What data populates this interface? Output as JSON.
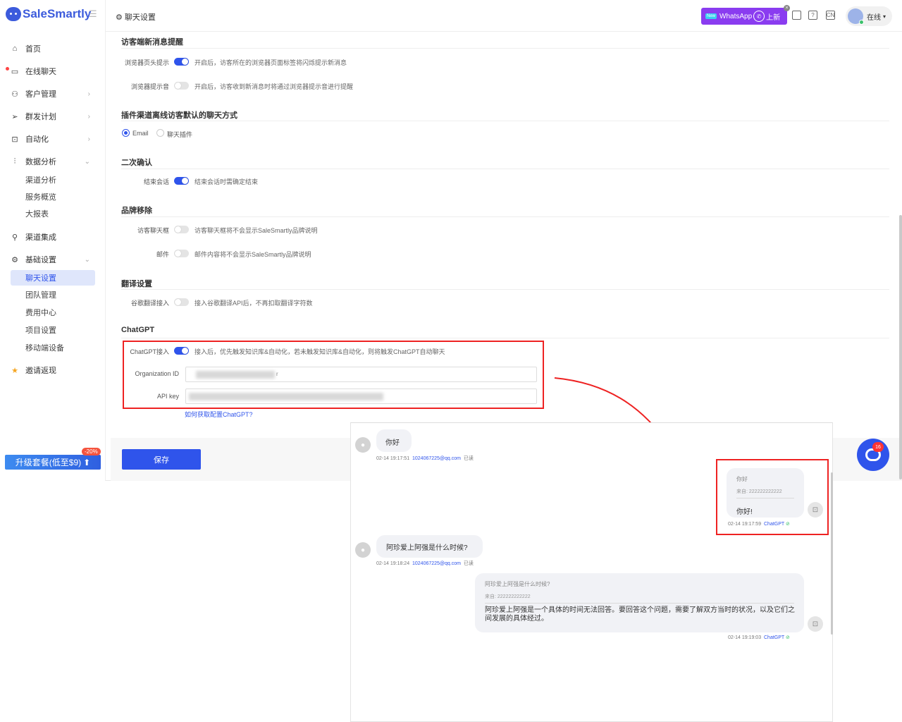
{
  "brand": {
    "name": "SaleSmartly"
  },
  "sidebar": {
    "items": [
      {
        "label": "首页",
        "icon": "home-icon"
      },
      {
        "label": "在线聊天",
        "icon": "chat-icon"
      },
      {
        "label": "客户管理",
        "icon": "users-icon"
      },
      {
        "label": "群发计划",
        "icon": "send-icon"
      },
      {
        "label": "自动化",
        "icon": "robot-icon"
      },
      {
        "label": "数据分析",
        "icon": "analytics-icon"
      },
      {
        "label": "渠道集成",
        "icon": "channels-icon"
      },
      {
        "label": "基础设置",
        "icon": "settings-icon"
      },
      {
        "label": "邀请返现",
        "icon": "star-icon"
      }
    ],
    "analytics_sub": [
      "渠道分析",
      "服务概览",
      "大报表"
    ],
    "settings_sub": [
      "聊天设置",
      "团队管理",
      "费用中心",
      "项目设置",
      "移动端设备"
    ],
    "upgrade_label": "升级套餐(低至$9)",
    "upgrade_badge": "-20%"
  },
  "header": {
    "breadcrumb": "聊天设置",
    "wa_new": "New",
    "wa_label": "WhatsApp",
    "wa_suffix": "上新",
    "wa_close": "×",
    "status": "在线"
  },
  "settings": {
    "sec1_title": "访客端新消息提醒",
    "browser_tab_label": "浏览器页头提示",
    "browser_tab_on": true,
    "browser_tab_desc": "开启后，访客所在的浏览器页面标签将闪烁提示新消息",
    "browser_sound_label": "浏览器提示音",
    "browser_sound_on": false,
    "browser_sound_desc": "开启后，访客收到新消息时将通过浏览器提示音进行提醒",
    "sec2_title": "插件渠道离线访客默认的聊天方式",
    "radio_email": "Email",
    "radio_plugin": "聊天插件",
    "sec3_title": "二次确认",
    "end_chat_label": "结束会话",
    "end_chat_on": true,
    "end_chat_desc": "结束会话时需确定结束",
    "sec4_title": "品牌移除",
    "visitor_box_label": "访客聊天框",
    "visitor_box_desc": "访客聊天框将不会显示SaleSmartly品牌说明",
    "mail_label": "邮件",
    "mail_desc": "邮件内容将不会显示SaleSmartly品牌说明",
    "sec5_title": "翻译设置",
    "google_label": "谷歌翻译接入",
    "google_desc": "接入谷歌翻译API后，不再扣取翻译字符数",
    "sec6_title": "ChatGPT",
    "gpt_label": "ChatGPT接入",
    "gpt_on": true,
    "gpt_desc": "接入后，优先触发知识库&自动化，若未触发知识库&自动化，则将触发ChatGPT自动聊天",
    "org_label": "Organization ID",
    "org_suffix": "r",
    "api_label": "API key",
    "help_link": "如何获取配置ChatGPT?",
    "save_label": "保存"
  },
  "chat": {
    "messages": [
      {
        "text": "你好",
        "time": "02-14 19:17:51",
        "email": "1024067225@qq.com",
        "status": "已读"
      },
      {
        "quote": "你好",
        "quote_from": "来自: 222222222222",
        "text": "你好!",
        "time": "02-14 19:17:59",
        "source": "ChatGPT"
      },
      {
        "text": "阿珍爱上阿强是什么时候?",
        "time": "02-14 19:18:24",
        "email": "1024067225@qq.com",
        "status": "已读"
      },
      {
        "quote": "阿珍爱上阿强是什么时候?",
        "quote_from": "来自: 222222222222",
        "text": "阿珍爱上阿强是一个具体的时间无法回答。要回答这个问题，需要了解双方当时的状况，以及它们之间发展的具体经过。",
        "time": "02-14 19:19:03",
        "source": "ChatGPT"
      }
    ],
    "badge_count": "16"
  },
  "colors": {
    "accent": "#2f54eb",
    "highlight": "#e22222",
    "whatsapp": "#8a3cf0"
  }
}
